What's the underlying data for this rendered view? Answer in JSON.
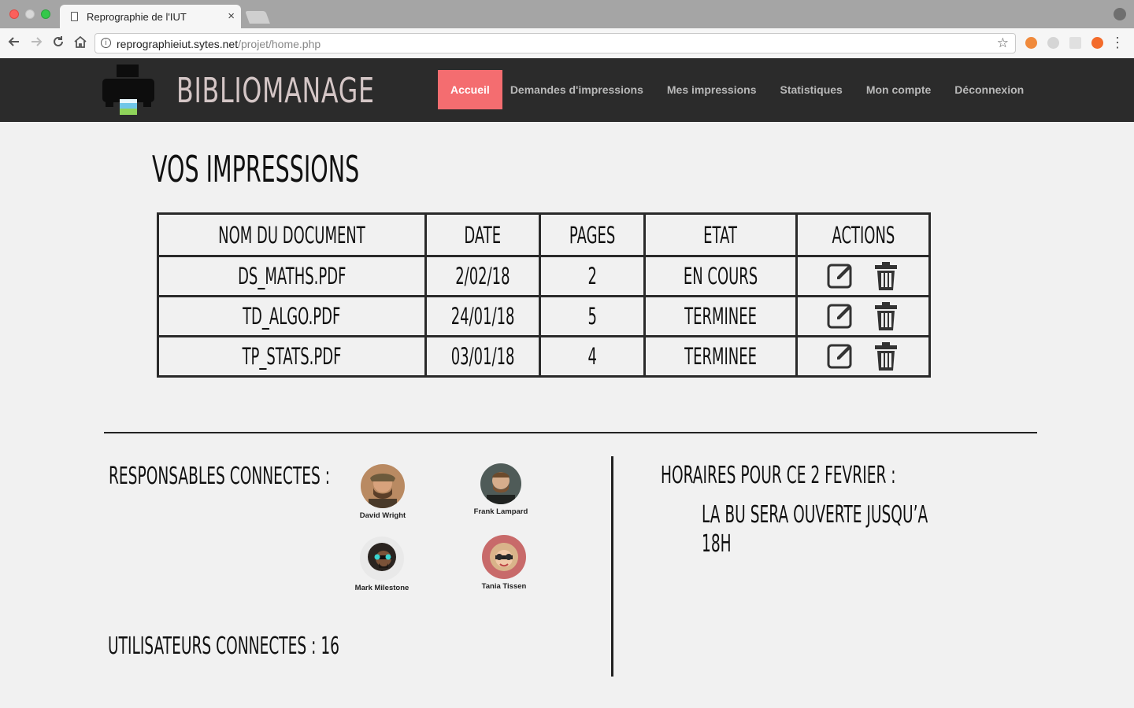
{
  "browser": {
    "tab_title": "Reprographie de l'IUT",
    "tab_close": "×",
    "url_host": "reprographieiut.sytes.net",
    "url_path": "/projet/home.php",
    "icons": [
      "back-arrow-icon",
      "forward-arrow-icon",
      "reload-icon",
      "home-icon",
      "info-icon",
      "star-icon",
      "menu-icon"
    ]
  },
  "header": {
    "brand": "BIBLIOMANAGE",
    "nav": [
      {
        "label": "Accueil",
        "active": true
      },
      {
        "label": "Demandes d'impressions"
      },
      {
        "label": "Mes impressions"
      },
      {
        "label": "Statistiques"
      },
      {
        "label": "Mon compte"
      },
      {
        "label": "Déconnexion"
      }
    ],
    "accent_color": "#f46d70",
    "bar_color": "#2b2b2b"
  },
  "main": {
    "title": "VOS IMPRESSIONS",
    "table": {
      "headers": [
        "NOM DU DOCUMENT",
        "DATE",
        "PAGES",
        "ETAT",
        "ACTIONS"
      ],
      "rows": [
        {
          "name": "DS_MATHS.PDF",
          "date": "2/02/18",
          "pages": "2",
          "state": "EN COURS"
        },
        {
          "name": "TD_ALGO.PDF",
          "date": "24/01/18",
          "pages": "5",
          "state": "TERMINEE"
        },
        {
          "name": "TP_STATS.PDF",
          "date": "03/01/18",
          "pages": "4",
          "state": "TERMINEE"
        }
      ],
      "row_icons": [
        "edit-icon",
        "trash-icon"
      ]
    }
  },
  "footer": {
    "responsables_title": "RESPONSABLES CONNECTES :",
    "responsables": [
      "David Wright",
      "Frank Lampard",
      "Mark Milestone",
      "Tania Tissen"
    ],
    "users_label": "UTILISATEURS CONNECTES : 16",
    "hours_title": "HORAIRES POUR CE 2 FEVRIER :",
    "hours_line1": "LA BU SERA OUVERTE JUSQU’A",
    "hours_line2": "18H"
  }
}
